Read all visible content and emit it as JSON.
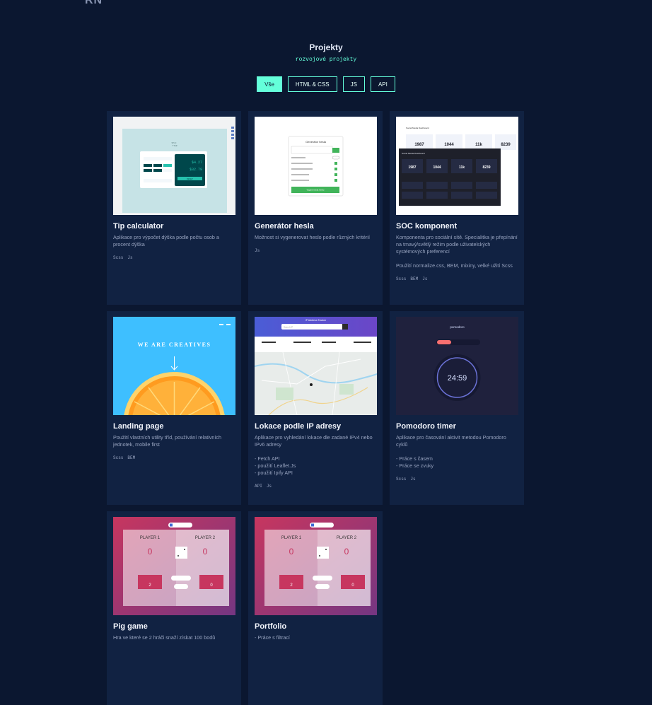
{
  "header": {
    "logo": "RN"
  },
  "section": {
    "title": "Projekty",
    "subtitle": "rozvojové projekty"
  },
  "filters": [
    "Vše",
    "HTML & CSS",
    "JS",
    "API"
  ],
  "projects": [
    {
      "title": "Tip calculator",
      "desc": "Aplikace pro výpočet dýška podle počtu osob a procent dýška",
      "tags": [
        "Scss",
        "Js"
      ],
      "thumb": {
        "brand": "SPLI\nTTER",
        "v1": "$4.27",
        "v2": "$32.79",
        "btn": "RESET"
      }
    },
    {
      "title": "Generátor hesla",
      "desc": "Možnost si vygenerovat heslo podle různých kritérií",
      "tags": [
        "Js"
      ],
      "thumb": {
        "heading": "Generátor hesla",
        "button": "Vygenerovat heslo"
      }
    },
    {
      "title": "SOC komponent",
      "desc": "Komponenta pro sociální sítě. Specialitka je přepínání na tmavý/světlý režim podle uživatelských systémových preferencí\n\nPoužití normalize.css, BEM, mixiny, velké užití Scss",
      "tags": [
        "Scss",
        "BEM",
        "Js"
      ],
      "thumb": {
        "heading": "Social Media Dashboard",
        "nums": [
          "1987",
          "1044",
          "11k",
          "8239"
        ]
      }
    },
    {
      "title": "Landing page",
      "desc": "Použití vlastních utility tříd, používání relativních jednotek, mobile first",
      "tags": [
        "Scss",
        "BEM"
      ],
      "thumb": {
        "text": "WE ARE CREATIVES"
      }
    },
    {
      "title": "Lokace podle IP adresy",
      "desc": "Aplikace pro vyhledání lokace dle zadané IPv4 nebo IPv6 adresy\n\n- Fetch API\n- použití Leaflet.Js\n- použití Ipify API",
      "tags": [
        "API",
        "Js"
      ],
      "thumb": {
        "heading": "IP Address Tracker",
        "placeholder": "Search IP"
      }
    },
    {
      "title": "Pomodoro timer",
      "desc": "Aplikace pro časování aktivit metodou Pomodoro cyklů\n\n- Práce s časem\n- Práce se zvuky",
      "tags": [
        "Scss",
        "Js"
      ],
      "thumb": {
        "brand": "pomodoro",
        "time": "24:59"
      }
    },
    {
      "title": "Pig game",
      "desc": "Hra ve které se 2 hráči snaží získat 100 bodů",
      "tags": [],
      "thumb": {
        "p1": "PLAYER 1",
        "p2": "PLAYER 2",
        "s1": "0",
        "s2": "0",
        "c1": "2",
        "c2": "0"
      }
    },
    {
      "title": "Portfolio",
      "desc": "- Práce s filtrací",
      "tags": [],
      "thumb": {
        "p1": "PLAYER 1",
        "p2": "PLAYER 2",
        "s1": "0",
        "s2": "0",
        "c1": "2",
        "c2": "0"
      }
    }
  ],
  "colors": {
    "accent": "#64ffda",
    "bg": "#0b1730",
    "card": "#112242"
  }
}
